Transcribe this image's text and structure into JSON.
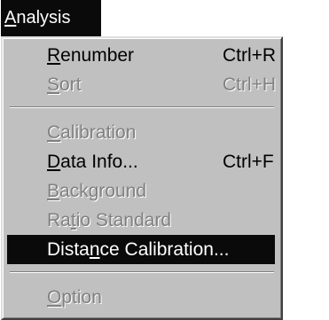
{
  "menubar": {
    "title_mnemonic": "A",
    "title_rest": "nalysis"
  },
  "menu": {
    "items": [
      {
        "pre": "",
        "mnemonic": "R",
        "post": "enumber",
        "shortcut": "Ctrl+R",
        "state": "enabled"
      },
      {
        "pre": "",
        "mnemonic": "S",
        "post": "ort",
        "shortcut": "Ctrl+H",
        "state": "disabled"
      },
      {
        "pre": "",
        "mnemonic": "C",
        "post": "alibration",
        "shortcut": "",
        "state": "disabled"
      },
      {
        "pre": "",
        "mnemonic": "D",
        "post": "ata Info...",
        "shortcut": "Ctrl+F",
        "state": "enabled"
      },
      {
        "pre": "",
        "mnemonic": "B",
        "post": "ackground",
        "shortcut": "",
        "state": "disabled"
      },
      {
        "pre": "Ra",
        "mnemonic": "t",
        "post": "io Standard",
        "shortcut": "",
        "state": "disabled"
      },
      {
        "pre": "Dista",
        "mnemonic": "n",
        "post": "ce Calibration...",
        "shortcut": "",
        "state": "highlighted"
      },
      {
        "pre": "",
        "mnemonic": "O",
        "post": "ption",
        "shortcut": "",
        "state": "disabled"
      }
    ]
  },
  "colors": {
    "menu_background": "#c0c0c0",
    "highlight": "#0a0a0a",
    "disabled_text": "#808080"
  }
}
